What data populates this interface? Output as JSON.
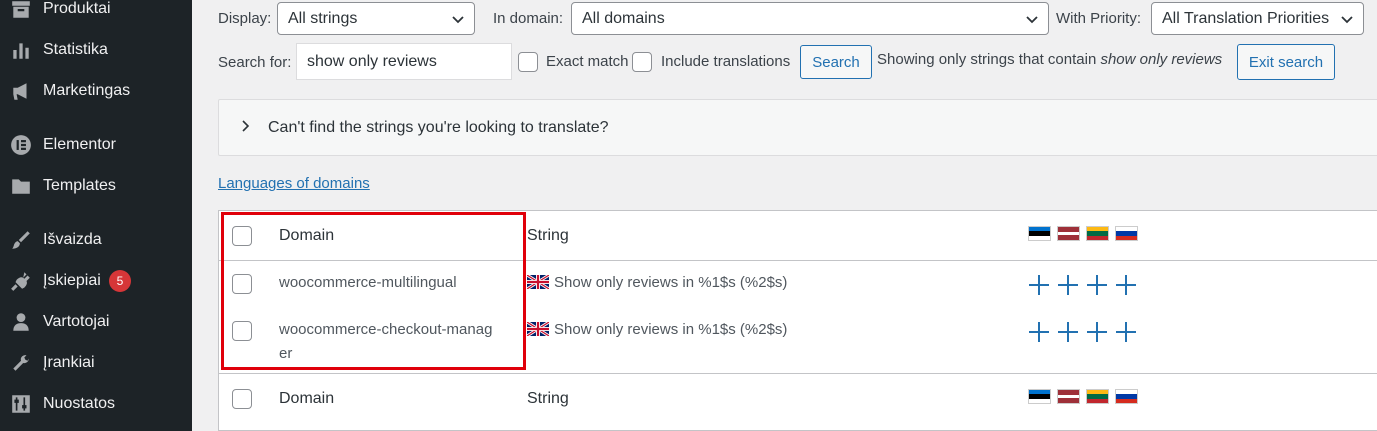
{
  "sidebar": {
    "items": [
      {
        "label": "Produktai",
        "icon": "archive-icon"
      },
      {
        "label": "Statistika",
        "icon": "bar-chart-icon"
      },
      {
        "label": "Marketingas",
        "icon": "megaphone-icon"
      },
      {
        "label": "Elementor",
        "icon": "elementor-icon"
      },
      {
        "label": "Templates",
        "icon": "folder-icon"
      },
      {
        "label": "Išvaizda",
        "icon": "paintbrush-icon"
      },
      {
        "label": "Įskiepiai",
        "icon": "plugin-icon",
        "badge": "5"
      },
      {
        "label": "Vartotojai",
        "icon": "user-icon"
      },
      {
        "label": "Įrankiai",
        "icon": "wrench-icon"
      },
      {
        "label": "Nuostatos",
        "icon": "settings-sliders-icon"
      }
    ]
  },
  "filters": {
    "display_label": "Display:",
    "display_value": "All strings",
    "domain_label": "In domain:",
    "domain_value": "All domains",
    "priority_label": "With Priority:",
    "priority_value": "All Translation Priorities",
    "search_label": "Search for:",
    "search_value": "show only reviews",
    "exact_match_label": "Exact match",
    "include_translations_label": "Include translations",
    "search_button": "Search",
    "showing_prefix": "Showing only strings that contain",
    "showing_term": "show only reviews",
    "exit_search_button": "Exit search"
  },
  "notice": {
    "text": "Can't find the strings you're looking to translate?"
  },
  "languages_link": "Languages of domains",
  "table": {
    "header": {
      "domain": "Domain",
      "string": "String"
    },
    "rows": [
      {
        "domain": "woocommerce-multilingual",
        "string": "Show only reviews in %1$s (%2$s)"
      },
      {
        "domain_line1": "woocommerce-checkout-manag",
        "domain_line2": "er",
        "string": "Show only reviews in %1$s (%2$s)"
      }
    ],
    "footer": {
      "domain": "Domain",
      "string": "String"
    },
    "flags": [
      "Estonian",
      "Latvian",
      "Lithuanian",
      "Russian"
    ]
  },
  "colors": {
    "highlight": "#e0000a",
    "link": "#2271b1",
    "sidebar_bg": "#1d2327"
  }
}
